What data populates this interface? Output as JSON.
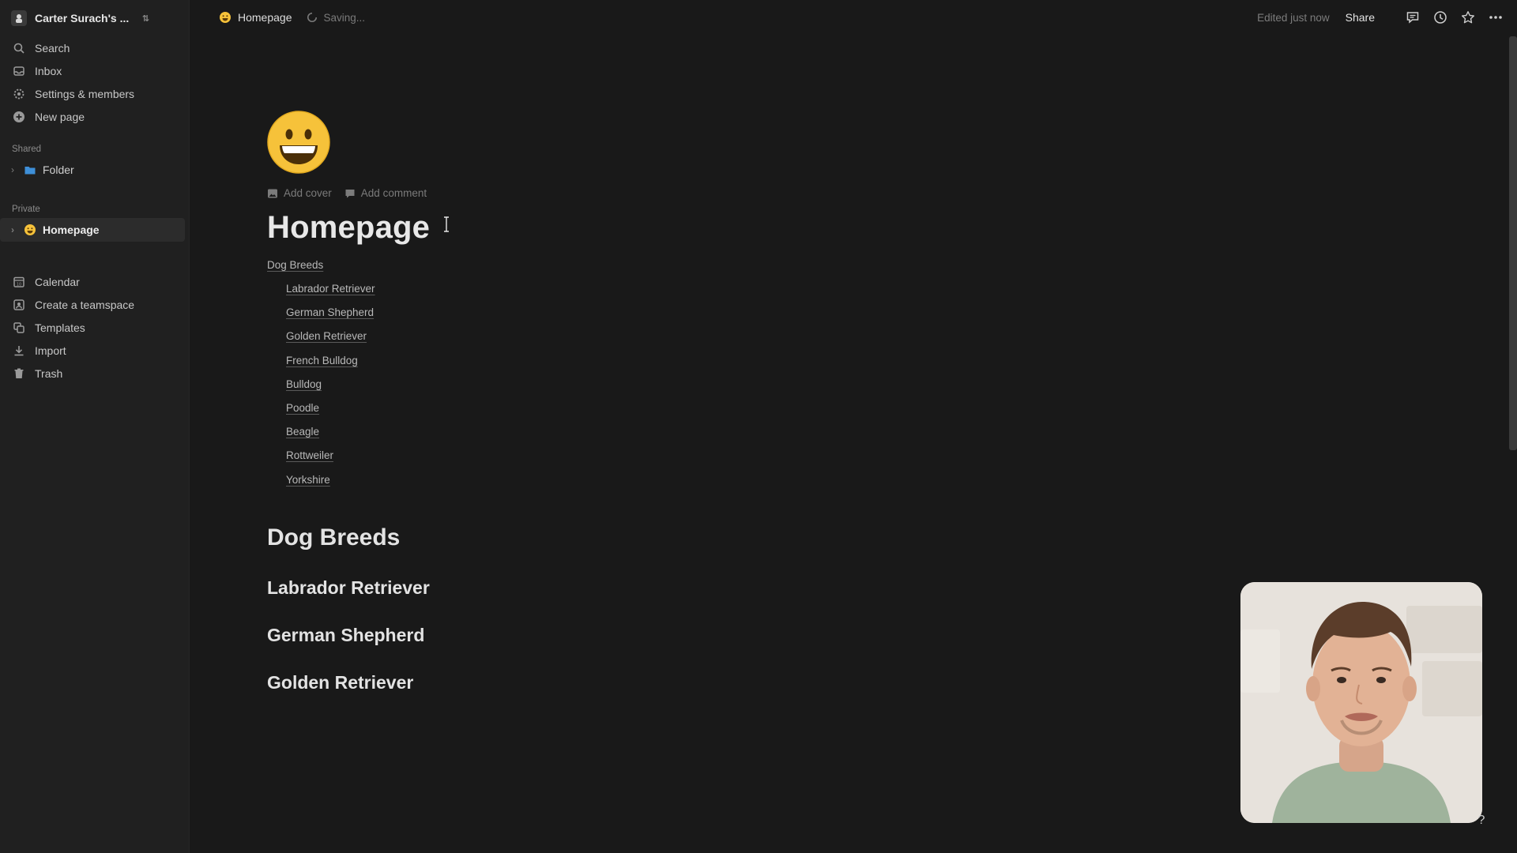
{
  "sidebar": {
    "workspace_name": "Carter Surach's ...",
    "nav": {
      "search": "Search",
      "inbox": "Inbox",
      "settings": "Settings & members",
      "new_page": "New page"
    },
    "shared_label": "Shared",
    "shared_items": [
      {
        "label": "Folder",
        "icon": "folder-icon"
      }
    ],
    "private_label": "Private",
    "private_items": [
      {
        "label": "Homepage",
        "icon": "smiley-emoji",
        "active": true
      }
    ],
    "bottom_nav": {
      "calendar": "Calendar",
      "teamspace": "Create a teamspace",
      "templates": "Templates",
      "import": "Import",
      "trash": "Trash"
    }
  },
  "topbar": {
    "breadcrumb": "Homepage",
    "status": "Saving...",
    "edited": "Edited just now",
    "share_label": "Share"
  },
  "page": {
    "icon": "smiley-emoji",
    "add_cover": "Add cover",
    "add_comment": "Add comment",
    "title": "Homepage",
    "toc": {
      "heading": "Dog Breeds",
      "items": [
        "Labrador Retriever",
        "German Shepherd",
        "Golden Retriever",
        "French Bulldog",
        "Bulldog",
        "Poodle",
        "Beagle",
        "Rottweiler",
        "Yorkshire"
      ]
    },
    "heading1": "Dog Breeds",
    "subheadings": [
      "Labrador Retriever",
      "German Shepherd",
      "Golden Retriever"
    ]
  },
  "help_label": "?",
  "colors": {
    "background": "#191919",
    "sidebar": "#202020",
    "emoji": "#F6C23A"
  }
}
